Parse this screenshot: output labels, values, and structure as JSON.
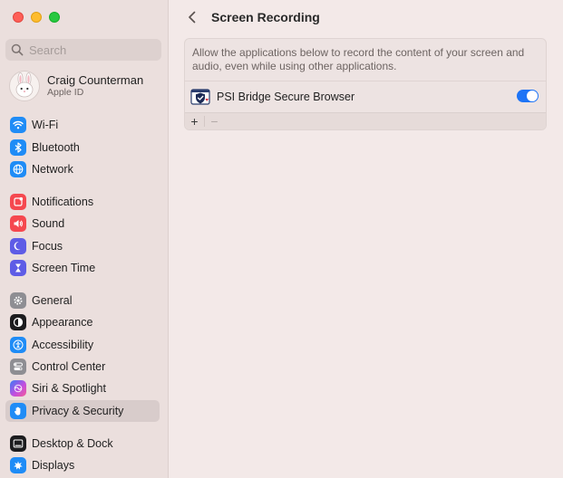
{
  "window": {
    "traffic_lights": [
      "close",
      "minimize",
      "maximize"
    ]
  },
  "sidebar": {
    "search_placeholder": "Search",
    "profile": {
      "name": "Craig Counterman",
      "subtitle": "Apple ID"
    },
    "items": [
      {
        "label": "Wi-Fi",
        "icon": "wifi-icon",
        "color": "#1f8cf6",
        "selected": false
      },
      {
        "label": "Bluetooth",
        "icon": "bluetooth-icon",
        "color": "#1f8cf6",
        "selected": false
      },
      {
        "label": "Network",
        "icon": "globe-icon",
        "color": "#1f8cf6",
        "selected": false
      },
      {
        "label": "Notifications",
        "icon": "bell-icon",
        "color": "#f5484f",
        "selected": false
      },
      {
        "label": "Sound",
        "icon": "speaker-icon",
        "color": "#f5484f",
        "selected": false
      },
      {
        "label": "Focus",
        "icon": "moon-icon",
        "color": "#5e5ce6",
        "selected": false
      },
      {
        "label": "Screen Time",
        "icon": "hourglass-icon",
        "color": "#5e5ce6",
        "selected": false
      },
      {
        "label": "General",
        "icon": "gear-icon",
        "color": "#8e8e93",
        "selected": false
      },
      {
        "label": "Appearance",
        "icon": "appearance-icon",
        "color": "#1c1c1e",
        "selected": false
      },
      {
        "label": "Accessibility",
        "icon": "accessibility-icon",
        "color": "#1f8cf6",
        "selected": false
      },
      {
        "label": "Control Center",
        "icon": "control-center-icon",
        "color": "#8e8e93",
        "selected": false
      },
      {
        "label": "Siri & Spotlight",
        "icon": "siri-icon",
        "color": "#b050e8",
        "selected": false
      },
      {
        "label": "Privacy & Security",
        "icon": "hand-icon",
        "color": "#1f8cf6",
        "selected": true
      },
      {
        "label": "Desktop & Dock",
        "icon": "dock-icon",
        "color": "#1c1c1e",
        "selected": false
      },
      {
        "label": "Displays",
        "icon": "display-icon",
        "color": "#1f8cf6",
        "selected": false
      }
    ]
  },
  "main": {
    "title": "Screen Recording",
    "description": "Allow the applications below to record the content of your screen and audio, even while using other applications.",
    "apps": [
      {
        "name": "PSI Bridge Secure Browser",
        "enabled": true,
        "icon": "shield-icon"
      }
    ],
    "add_label": "+",
    "remove_label": "−",
    "accent": "#1e74f6"
  }
}
